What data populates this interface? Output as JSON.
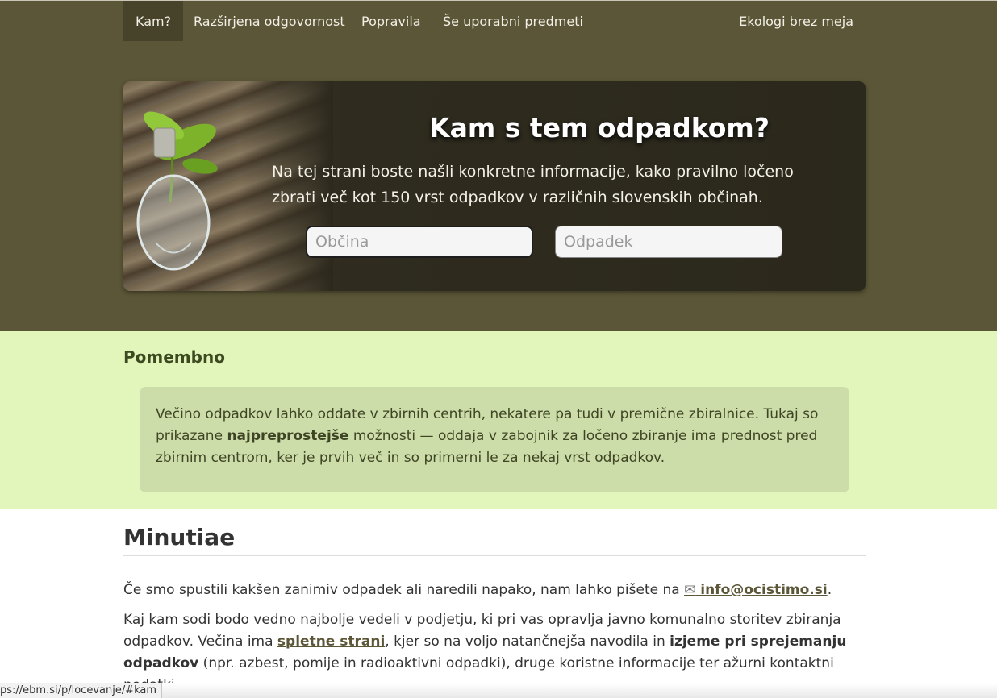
{
  "nav": {
    "items": [
      {
        "label": "Kam?"
      },
      {
        "label": "Razširjena odgovornost"
      },
      {
        "label": "Popravila"
      },
      {
        "label": "Še uporabni predmeti"
      }
    ],
    "right_label": "Ekologi brez meja"
  },
  "hero": {
    "title": "Kam s tem odpadkom?",
    "text": "Na tej strani boste našli konkretne informacije, kako pravilno ločeno zbrati več kot 150 vrst odpadkov v različnih slovenskih občinah.",
    "municipality_placeholder": "Občina",
    "waste_placeholder": "Odpadek"
  },
  "important": {
    "heading": "Pomembno",
    "text_before": "Večino odpadkov lahko oddate v zbirnih centrih, nekatere pa tudi v premične zbiralnice. Tukaj so prikazane ",
    "text_bold": "najpreprostejše",
    "text_after": " možnosti — oddaja v zabojnik za ločeno zbiranje ima prednost pred zbirnim centrom, ker je prvih več in so primerni le za nekaj vrst odpadkov."
  },
  "minutiae": {
    "heading": "Minutiae",
    "p1_before": "Če smo spustili kakšen zanimiv odpadek ali naredili napako, nam lahko pišete na ",
    "mail_icon": "✉",
    "email": " info@ocistimo.si",
    "p1_after": ".",
    "p2_a": "Kaj kam sodi bodo vedno najbolje vedeli v podjetju, ki pri vas opravlja javno komunalno storitev zbiranja odpadkov. Večina ima ",
    "p2_link": "spletne strani",
    "p2_b": ", kjer so na voljo natančnejša navodila in ",
    "p2_bold": "izjeme pri sprejemanju odpadkov",
    "p2_c": " (npr. azbest, pomije in radioaktivni odpadki), druge koristne informacije ter ažurni kontaktni podatki."
  },
  "status_url": "ps://ebm.si/p/locevanje/#kam",
  "colors": {
    "header_bg": "#5b5637",
    "important_bg": "#e2f5bb",
    "notice_bg": "#ccdda9"
  }
}
